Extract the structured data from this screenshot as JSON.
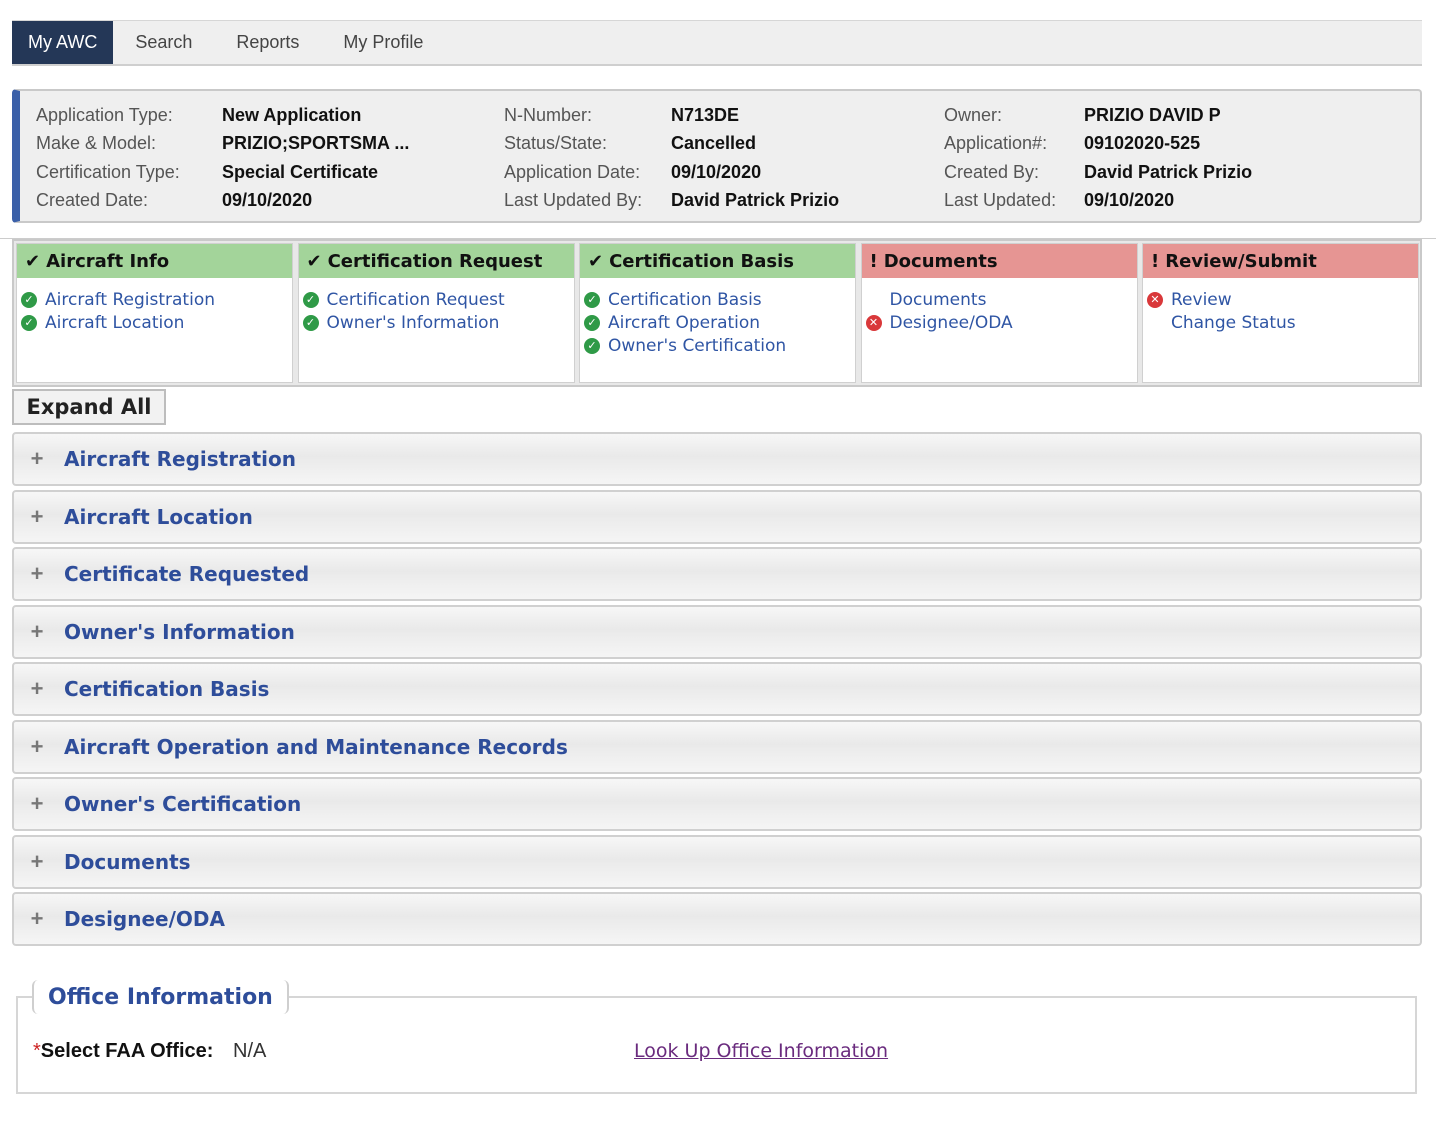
{
  "nav": {
    "tabs": [
      {
        "label": "My AWC",
        "active": true
      },
      {
        "label": "Search",
        "active": false
      },
      {
        "label": "Reports",
        "active": false
      },
      {
        "label": "My Profile",
        "active": false
      }
    ]
  },
  "summary": {
    "col1": [
      {
        "label": "Application Type:",
        "value": "New Application"
      },
      {
        "label": "Make & Model:",
        "value": "PRIZIO;SPORTSMA ..."
      },
      {
        "label": "Certification Type:",
        "value": "Special Certificate"
      },
      {
        "label": "Created Date:",
        "value": "09/10/2020"
      }
    ],
    "col2": [
      {
        "label": "N-Number:",
        "value": "N713DE"
      },
      {
        "label": "Status/State:",
        "value": "Cancelled"
      },
      {
        "label": "Application Date:",
        "value": "09/10/2020"
      },
      {
        "label": "Last Updated By:",
        "value": "David Patrick Prizio"
      }
    ],
    "col3": [
      {
        "label": "Owner:",
        "value": "PRIZIO DAVID P"
      },
      {
        "label": "Application#:",
        "value": "09102020-525"
      },
      {
        "label": "Created By:",
        "value": "David Patrick Prizio"
      },
      {
        "label": "Last Updated:",
        "value": "09/10/2020"
      }
    ]
  },
  "steps": [
    {
      "title": "Aircraft Info",
      "mark": "✔",
      "status": "ok",
      "items": [
        {
          "label": "Aircraft Registration",
          "status": "ok"
        },
        {
          "label": "Aircraft Location",
          "status": "ok"
        }
      ]
    },
    {
      "title": "Certification Request",
      "mark": "✔",
      "status": "ok",
      "items": [
        {
          "label": "Certification Request",
          "status": "ok"
        },
        {
          "label": "Owner's Information",
          "status": "ok"
        }
      ]
    },
    {
      "title": "Certification Basis",
      "mark": "✔",
      "status": "ok",
      "items": [
        {
          "label": "Certification Basis",
          "status": "ok"
        },
        {
          "label": "Aircraft Operation",
          "status": "ok"
        },
        {
          "label": "Owner's Certification",
          "status": "ok"
        }
      ]
    },
    {
      "title": "Documents",
      "mark": "!",
      "status": "err",
      "items": [
        {
          "label": "Documents",
          "status": "none"
        },
        {
          "label": "Designee/ODA",
          "status": "err"
        }
      ]
    },
    {
      "title": "Review/Submit",
      "mark": "!",
      "status": "err",
      "items": [
        {
          "label": "Review",
          "status": "err"
        },
        {
          "label": "Change Status",
          "status": "none"
        }
      ]
    }
  ],
  "expand_all_label": "Expand All",
  "sections": [
    "Aircraft Registration",
    "Aircraft Location",
    "Certificate Requested",
    "Owner's Information",
    "Certification Basis",
    "Aircraft Operation and Maintenance Records",
    "Owner's Certification",
    "Documents",
    "Designee/ODA"
  ],
  "office": {
    "legend": "Office Information",
    "required_mark": "*",
    "label": "Select FAA Office:",
    "value": "N/A",
    "link": "Look Up Office Information"
  },
  "colors": {
    "nav_active": "#243757",
    "accent_bar": "#3a5fa8",
    "step_ok": "#a3d49a",
    "step_err": "#e69593",
    "link_blue": "#2f55a4",
    "section_title": "#2e4d9a",
    "visited_link": "#6a2b7e"
  }
}
